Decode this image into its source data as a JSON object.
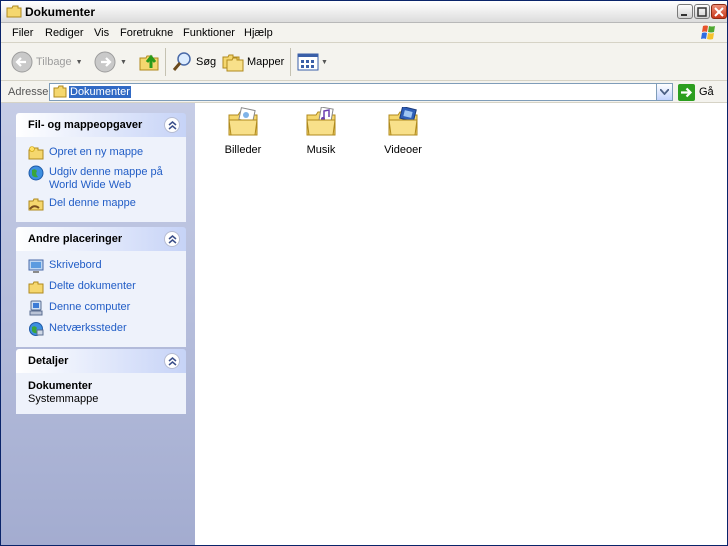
{
  "window": {
    "title": "Dokumenter"
  },
  "menu": [
    "Filer",
    "Rediger",
    "Vis",
    "Foretrukne",
    "Funktioner",
    "Hjælp"
  ],
  "toolbar": {
    "back_label": "Tilbage",
    "search_label": "Søg",
    "folders_label": "Mapper"
  },
  "address": {
    "label": "Adresse",
    "value": "Dokumenter",
    "go_label": "Gå"
  },
  "tasks_panel": {
    "title": "Fil- og mappeopgaver",
    "items": [
      {
        "label": "Opret en ny mappe",
        "icon": "new-folder-icon"
      },
      {
        "label": "Udgiv denne mappe på World Wide Web",
        "icon": "publish-web-icon"
      },
      {
        "label": "Del denne mappe",
        "icon": "share-folder-icon"
      }
    ]
  },
  "places_panel": {
    "title": "Andre placeringer",
    "items": [
      {
        "label": "Skrivebord",
        "icon": "desktop-icon"
      },
      {
        "label": "Delte dokumenter",
        "icon": "shared-documents-icon"
      },
      {
        "label": "Denne computer",
        "icon": "my-computer-icon"
      },
      {
        "label": "Netværkssteder",
        "icon": "network-places-icon"
      }
    ]
  },
  "details_panel": {
    "title": "Detaljer",
    "name": "Dokumenter",
    "type": "Systemmappe"
  },
  "folders": [
    {
      "label": "Billeder",
      "icon": "pictures-folder-icon"
    },
    {
      "label": "Musik",
      "icon": "music-folder-icon"
    },
    {
      "label": "Videoer",
      "icon": "videos-folder-icon"
    }
  ],
  "colors": {
    "task_link": "#215dc6",
    "folder_yellow": "#f5d76e",
    "pane_bg": "#a3acd0"
  }
}
